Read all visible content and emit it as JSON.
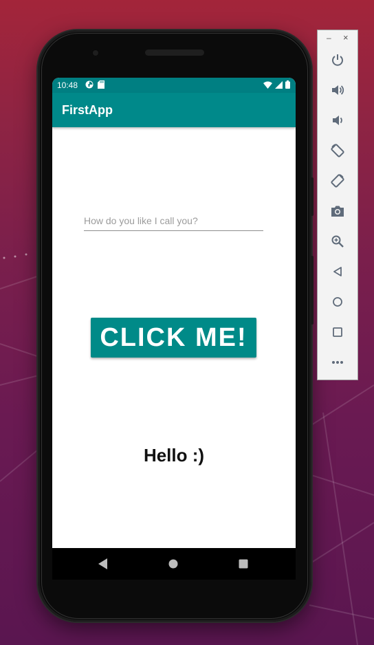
{
  "statusbar": {
    "time": "10:48"
  },
  "appbar": {
    "title": "FirstApp"
  },
  "form": {
    "name_placeholder": "How do you like I call you?",
    "name_value": "",
    "button_label": "CLICK ME!",
    "greeting": "Hello :)"
  },
  "colors": {
    "accent": "#008a88",
    "statusbar": "#007f82",
    "appbar": "#00898a"
  },
  "toolbar": {
    "minimize": "–",
    "close": "×",
    "buttons": [
      "power-icon",
      "volume-up-icon",
      "volume-down-icon",
      "rotate-left-icon",
      "rotate-right-icon",
      "camera-icon",
      "zoom-icon",
      "back-icon",
      "home-icon",
      "overview-icon",
      "more-icon"
    ]
  },
  "navbar": {
    "buttons": [
      "back-icon",
      "home-icon",
      "recents-icon"
    ]
  }
}
